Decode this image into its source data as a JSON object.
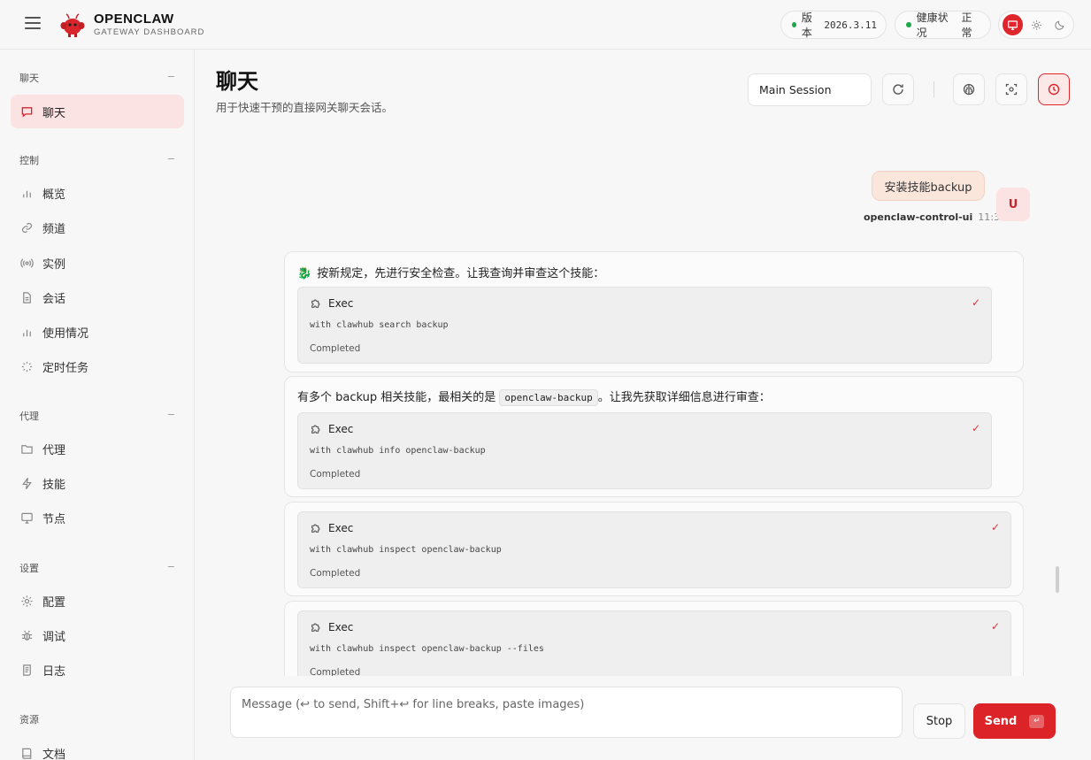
{
  "brand": {
    "title": "OPENCLAW",
    "subtitle": "GATEWAY DASHBOARD"
  },
  "status": {
    "version_label": "版本",
    "version_value": "2026.3.11",
    "health_label": "健康状况",
    "health_value": "正常",
    "health_color": "#1ea84a"
  },
  "theme": {
    "options": [
      "monitor-icon",
      "sun-icon",
      "moon-icon"
    ],
    "active": "monitor-icon",
    "accent": "#e0262d"
  },
  "sidebar": {
    "sections": [
      {
        "title": "聊天",
        "items": [
          {
            "label": "聊天",
            "icon": "chat-icon",
            "active": true
          }
        ]
      },
      {
        "title": "控制",
        "items": [
          {
            "label": "概览",
            "icon": "bar-chart-icon"
          },
          {
            "label": "频道",
            "icon": "link-icon"
          },
          {
            "label": "实例",
            "icon": "radio-icon"
          },
          {
            "label": "会话",
            "icon": "document-icon"
          },
          {
            "label": "使用情况",
            "icon": "bar-chart-icon"
          },
          {
            "label": "定时任务",
            "icon": "loader-icon"
          }
        ]
      },
      {
        "title": "代理",
        "items": [
          {
            "label": "代理",
            "icon": "folder-icon"
          },
          {
            "label": "技能",
            "icon": "zap-icon"
          },
          {
            "label": "节点",
            "icon": "monitor-icon"
          }
        ]
      },
      {
        "title": "设置",
        "items": [
          {
            "label": "配置",
            "icon": "gear-icon"
          },
          {
            "label": "调试",
            "icon": "bug-icon"
          },
          {
            "label": "日志",
            "icon": "scroll-icon"
          }
        ]
      },
      {
        "title": "资源",
        "items": [
          {
            "label": "文档",
            "icon": "book-icon"
          }
        ]
      }
    ]
  },
  "header": {
    "title": "聊天",
    "subtitle": "用于快速干预的直接网关聊天会话。",
    "session": "Main Session"
  },
  "chat": {
    "user_message": {
      "text": "安装技能backup",
      "sender": "openclaw-control-ui",
      "time": "11:38",
      "avatar": "U"
    },
    "assistant": {
      "msg1_text": "按新规定，先进行安全检查。让我查询并审查这个技能：",
      "msg2_pre": "有多个 backup 相关技能，最相关的是",
      "msg2_code": "openclaw-backup",
      "msg2_post": "。让我先获取详细信息进行审查：",
      "tools": [
        {
          "name": "Exec",
          "command": "with clawhub search backup",
          "status": "Completed"
        },
        {
          "name": "Exec",
          "command": "with clawhub info openclaw-backup",
          "status": "Completed"
        },
        {
          "name": "Exec",
          "command": "with clawhub inspect openclaw-backup",
          "status": "Completed"
        },
        {
          "name": "Exec",
          "command": "with clawhub inspect openclaw-backup --files",
          "status": "Completed"
        }
      ]
    }
  },
  "composer": {
    "placeholder": "Message (↩ to send, Shift+↩ for line breaks, paste images)",
    "stop_label": "Stop",
    "send_label": "Send",
    "send_key": "↵"
  }
}
